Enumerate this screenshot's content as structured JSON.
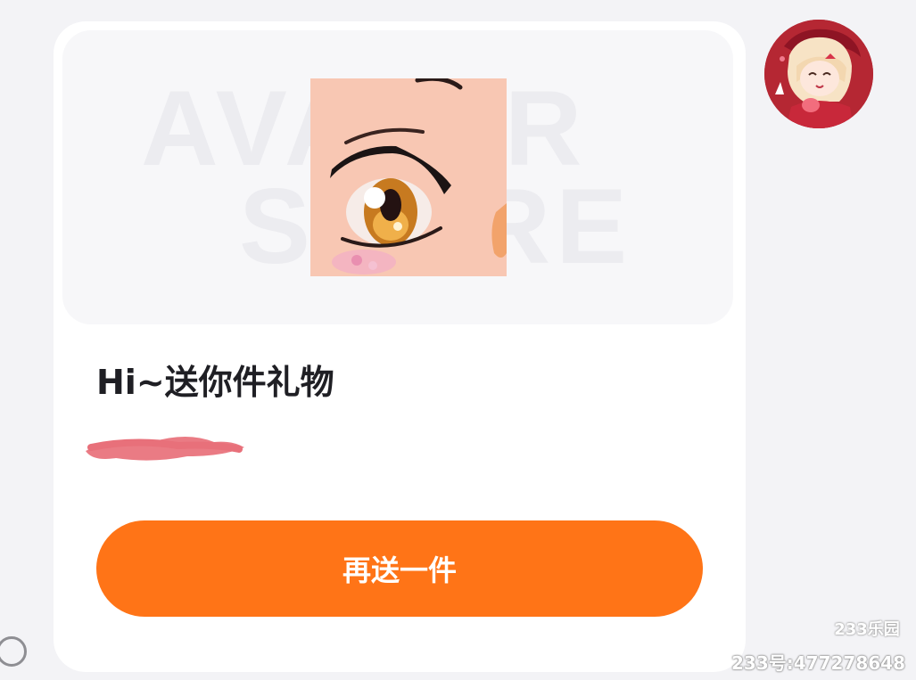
{
  "gift_card": {
    "preview_watermark_line1": "AVATAR",
    "preview_watermark_line2": "STORE",
    "title": "Hi~送你件礼物",
    "resend_button_label": "再送一件"
  },
  "sender_avatar": {
    "description": "anime-avatar"
  },
  "overlay_watermark": {
    "logo_text": "233乐园",
    "id_text": "233号:477278648"
  },
  "colors": {
    "accent": "#ff7417",
    "card_bg": "#ffffff",
    "page_bg": "#f3f3f6",
    "redaction": "#e8707a"
  }
}
